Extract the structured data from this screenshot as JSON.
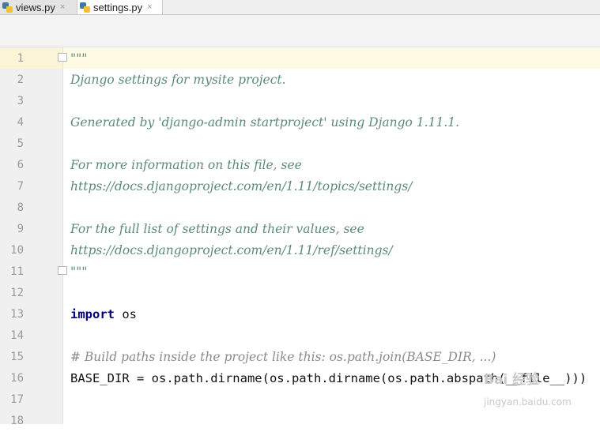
{
  "tabs": [
    {
      "label": "views.py",
      "icon": "python-file-icon",
      "active": false
    },
    {
      "label": "settings.py",
      "icon": "python-file-icon",
      "active": true
    }
  ],
  "close_glyph": "×",
  "line_numbers": [
    "1",
    "2",
    "3",
    "4",
    "5",
    "6",
    "7",
    "8",
    "9",
    "10",
    "11",
    "12",
    "13",
    "14",
    "15",
    "16",
    "17",
    "18"
  ],
  "code": {
    "l1": "\"\"\"",
    "l2": "Django settings for mysite project.",
    "l4": "Generated by 'django-admin startproject' using Django 1.11.1.",
    "l6": "For more information on this file, see",
    "l7": "https://docs.djangoproject.com/en/1.11/topics/settings/",
    "l9": "For the full list of settings and their values, see",
    "l10": "https://docs.djangoproject.com/en/1.11/ref/settings/",
    "l11": "\"\"\"",
    "l13_kw": "import",
    "l13_rest": " os",
    "l15": "# Build paths inside the project like this: os.path.join(BASE_DIR, ...)",
    "l16": "BASE_DIR = os.path.dirname(os.path.dirname(os.path.abspath(__file__)))"
  },
  "colors": {
    "docstring": "#5c8a78",
    "keyword": "#000080",
    "comment": "#8a8a8a",
    "current_line": "#fffae3"
  },
  "watermark": {
    "line1": "Bai 经验",
    "line2": "jingyan.baidu.com"
  }
}
